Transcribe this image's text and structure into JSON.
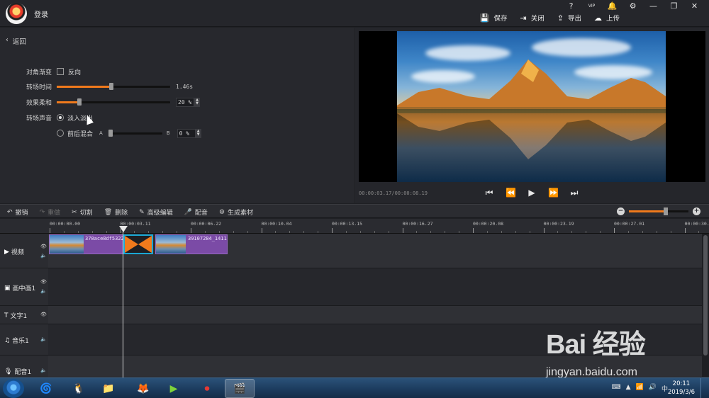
{
  "app": {
    "login": "登录",
    "system_icons": [
      "?",
      "VIP",
      "🔔",
      "⚙",
      "—",
      "❐",
      "✕"
    ],
    "toolbar": [
      {
        "icon": "save-icon",
        "glyph": "💾",
        "label": "保存"
      },
      {
        "icon": "close-doc-icon",
        "glyph": "⇥",
        "label": "关闭"
      },
      {
        "icon": "export-icon",
        "glyph": "⇪",
        "label": "导出"
      },
      {
        "icon": "upload-icon",
        "glyph": "☁",
        "label": "上传"
      }
    ]
  },
  "settings": {
    "back_label": "返回",
    "diagonal": {
      "label": "对角渐变",
      "checkbox_label": "反向",
      "checked": false
    },
    "duration": {
      "label": "转场时间",
      "value_text": "1.46s",
      "fraction": 0.48
    },
    "softness": {
      "label": "效果柔和",
      "value": "20 %",
      "fraction": 0.2
    },
    "sound": {
      "label": "转场声音",
      "options": [
        {
          "label": "淡入淡出",
          "selected": true
        },
        {
          "label": "前后混合",
          "selected": false
        }
      ],
      "mix_left": "A",
      "mix_right": "B",
      "mix_value": "0 %",
      "mix_fraction": 0.0
    }
  },
  "preview": {
    "timecode": "00:00:03.17/00:00:08.19",
    "controls": [
      "skip-start-icon",
      "prev-frame-icon",
      "play-icon",
      "next-frame-icon",
      "skip-end-icon"
    ]
  },
  "edit_toolbar": {
    "items": [
      {
        "icon": "undo-icon",
        "glyph": "↶",
        "label": "撤销",
        "enabled": true
      },
      {
        "icon": "redo-icon",
        "glyph": "↷",
        "label": "重做",
        "enabled": false
      },
      {
        "icon": "cut-icon",
        "glyph": "✂",
        "label": "切割",
        "enabled": true
      },
      {
        "icon": "delete-icon",
        "glyph": "🗑",
        "label": "删除",
        "enabled": true
      },
      {
        "icon": "advanced-edit-icon",
        "glyph": "✎",
        "label": "高级编辑",
        "enabled": true
      },
      {
        "icon": "dub-icon",
        "glyph": "🎤",
        "label": "配音",
        "enabled": true
      },
      {
        "icon": "generate-icon",
        "glyph": "⚙",
        "label": "生成素材",
        "enabled": true
      }
    ],
    "zoom_fraction": 0.62
  },
  "timeline": {
    "ruler": [
      "00:00:00.00",
      "00:00:03.11",
      "00:00:06.22",
      "00:00:10.04",
      "00:00:13.15",
      "00:00:16.27",
      "00:00:20.08",
      "00:00:23.19",
      "00:00:27.01",
      "00:00:30."
    ],
    "tracks": [
      {
        "name": "视频",
        "icon": "video-track-icon",
        "glyph": "▶"
      },
      {
        "name": "画中画1",
        "icon": "pip-track-icon",
        "glyph": "▣"
      },
      {
        "name": "文字1",
        "icon": "text-track-icon",
        "glyph": "T"
      },
      {
        "name": "音乐1",
        "icon": "music-track-icon",
        "glyph": "♫"
      },
      {
        "name": "配音1",
        "icon": "mic-track-icon",
        "glyph": "🎙"
      }
    ],
    "clips": [
      {
        "name": "370ace8df5322"
      },
      {
        "name": "39107284_1411"
      }
    ]
  },
  "taskbar": {
    "apps": [
      {
        "icon": "360-icon",
        "glyph": "🌀"
      },
      {
        "icon": "qq-icon",
        "glyph": "🐧"
      },
      {
        "icon": "folder-icon",
        "glyph": "📁"
      },
      {
        "icon": "firefox-icon",
        "glyph": "🦊"
      },
      {
        "icon": "editor-icon",
        "glyph": "▶"
      },
      {
        "icon": "record-icon",
        "glyph": "⏺"
      },
      {
        "icon": "video-editor-icon",
        "glyph": "🎬"
      }
    ],
    "time": "20:11",
    "date": "2019/3/6"
  },
  "watermark": {
    "big": "Bai 经验",
    "small": "jingyan.baidu.com"
  }
}
